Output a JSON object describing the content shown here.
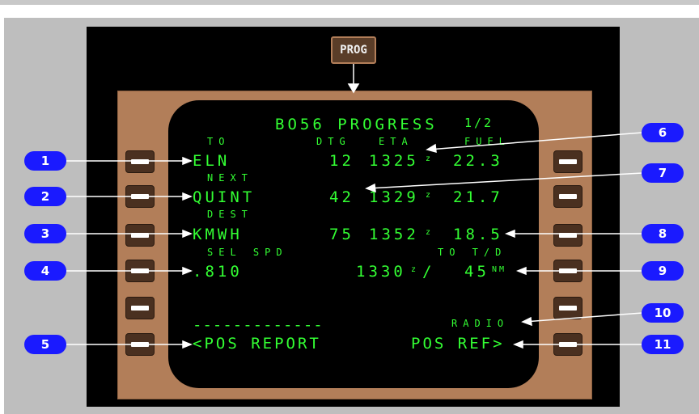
{
  "prog_key": "PROG",
  "screen": {
    "title": "BO56 PROGRESS",
    "page": "1/2",
    "headers": {
      "to": "TO",
      "dtg": "DTG",
      "eta": "ETA",
      "fuel": "FUEL"
    },
    "rows": [
      {
        "name": "ELN",
        "dtg": "12",
        "eta": "1325",
        "fuel": "22.3"
      },
      {
        "name": "QUINT",
        "dtg": "42",
        "eta": "1329",
        "fuel": "21.7"
      },
      {
        "name": "KMWH",
        "dtg": "75",
        "eta": "1352",
        "fuel": "18.5"
      }
    ],
    "next_label": "NEXT",
    "dest_label": "DEST",
    "sel_spd_label": "SEL SPD",
    "sel_spd_value": ".810",
    "to_td_label": "TO T/D",
    "td_time": "1330",
    "td_separator": "/",
    "td_distance": "45",
    "nm_unit": "NM",
    "z_suffix": "z",
    "dashes": "-------------",
    "radio_label": "RADIO",
    "pos_report": "<POS REPORT",
    "pos_ref": "POS REF>"
  },
  "callouts": [
    "1",
    "2",
    "3",
    "4",
    "5",
    "6",
    "7",
    "8",
    "9",
    "10",
    "11"
  ]
}
